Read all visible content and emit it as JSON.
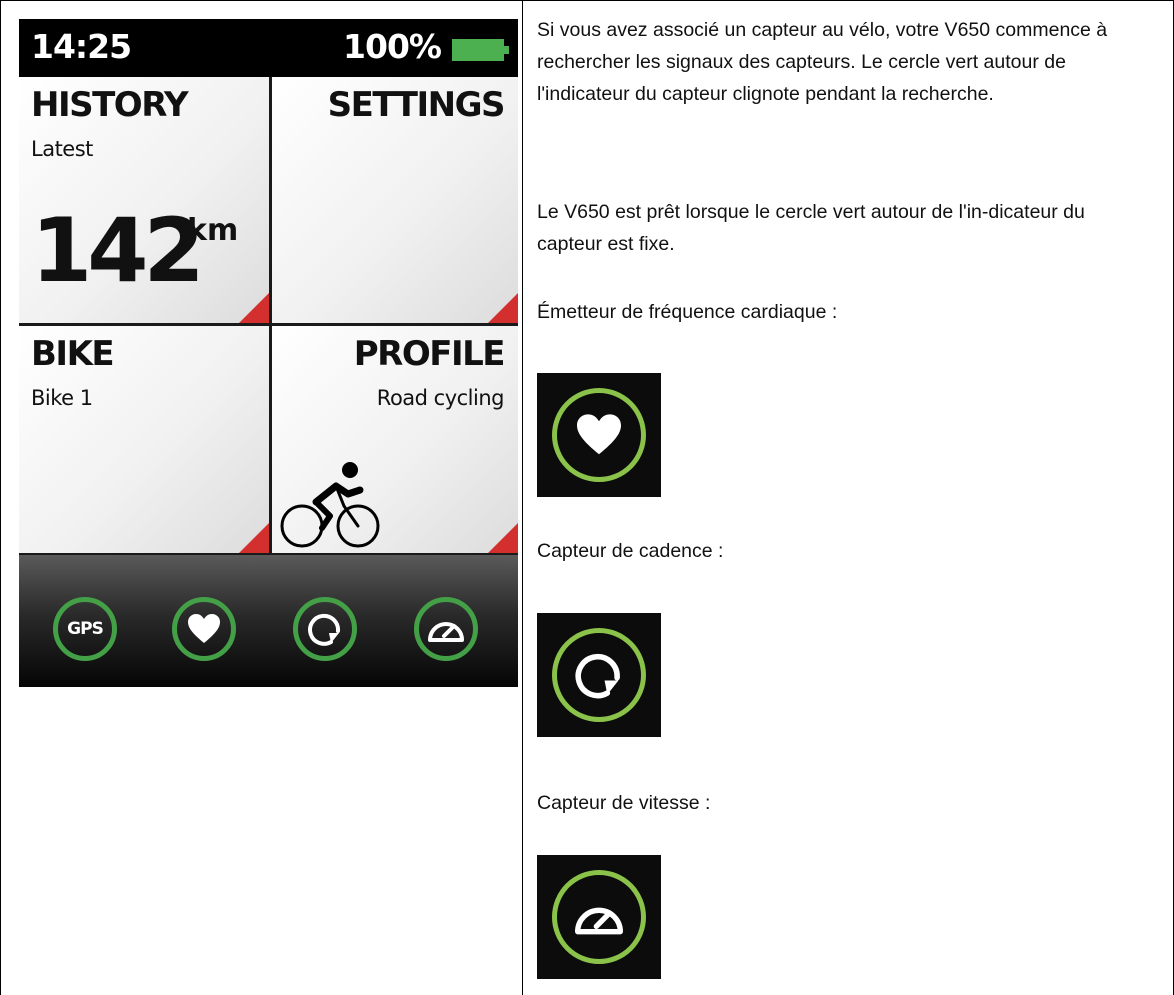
{
  "device": {
    "status": {
      "time": "14:25",
      "battery_percent": "100%",
      "battery_level": 1.0
    },
    "tiles": {
      "history": {
        "title": "HISTORY",
        "subtitle": "Latest",
        "value": "142",
        "unit": "km"
      },
      "settings": {
        "title": "SETTINGS"
      },
      "bike": {
        "title": "BIKE",
        "subtitle": "Bike 1"
      },
      "profile": {
        "title": "PROFILE",
        "subtitle": "Road cycling",
        "icon": "cyclist-icon"
      }
    },
    "sensors": [
      {
        "name": "gps",
        "label": "GPS",
        "icon": "gps-icon"
      },
      {
        "name": "heart-rate",
        "icon": "heart-icon"
      },
      {
        "name": "cadence",
        "icon": "cadence-icon"
      },
      {
        "name": "speed",
        "icon": "speedometer-icon"
      }
    ],
    "colors": {
      "sensor_ring": "#43a047",
      "corner_accent": "#d32f2f",
      "battery": "#4caf50"
    }
  },
  "doc": {
    "p1": "Si vous avez associé un capteur au vélo, votre V650 commence à rechercher les signaux des capteurs. Le cercle vert autour de l'indicateur du capteur clignote pendant la recherche.",
    "p2": "Le V650 est prêt lorsque le cercle vert autour de l'in-dicateur du capteur est fixe.",
    "hr_label": "Émetteur de fréquence cardiaque :",
    "cadence_label": "Capteur de cadence :",
    "speed_label": "Capteur de vitesse :",
    "icons": [
      "heart-icon",
      "cadence-icon",
      "speedometer-icon"
    ],
    "colors": {
      "icon_ring": "#8bc34a"
    }
  }
}
